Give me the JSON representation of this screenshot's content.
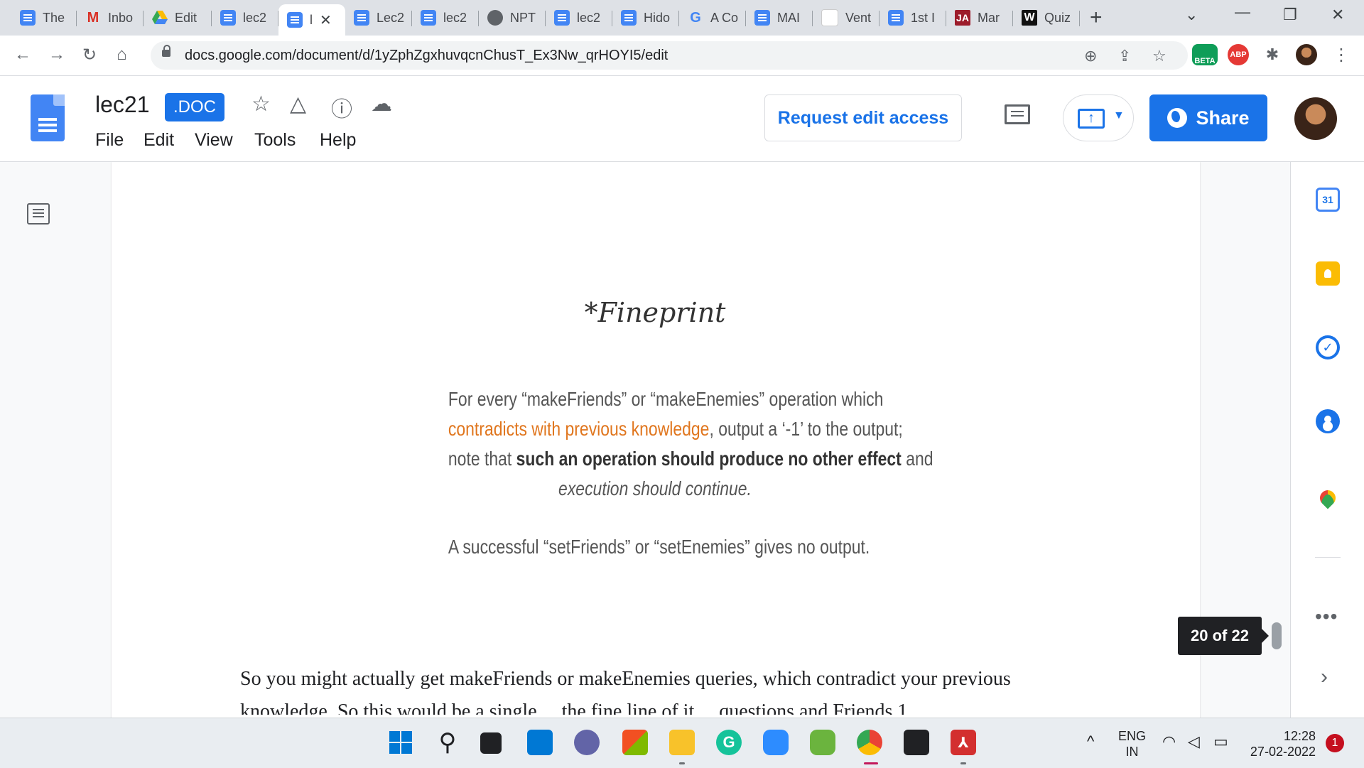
{
  "tabs": [
    {
      "label": "The",
      "icon": "docs-icon",
      "active": false
    },
    {
      "label": "Inbo",
      "icon": "gmail-icon",
      "active": false
    },
    {
      "label": "Edit",
      "icon": "drive-icon",
      "active": false
    },
    {
      "label": "lec2",
      "icon": "docs-icon",
      "active": false
    },
    {
      "label": "l",
      "icon": "docs-icon",
      "active": true
    },
    {
      "label": "Lec2",
      "icon": "docs-icon",
      "active": false
    },
    {
      "label": "lec2",
      "icon": "docs-icon",
      "active": false
    },
    {
      "label": "NPT",
      "icon": "globe-icon",
      "active": false
    },
    {
      "label": "lec2",
      "icon": "docs-icon",
      "active": false
    },
    {
      "label": "Hido",
      "icon": "docs-icon",
      "active": false
    },
    {
      "label": "A Co",
      "icon": "google-icon",
      "active": false
    },
    {
      "label": "MAI",
      "icon": "docs-icon",
      "active": false
    },
    {
      "label": "Vent",
      "icon": "blank-icon",
      "active": false
    },
    {
      "label": "1st I",
      "icon": "docs-icon",
      "active": false
    },
    {
      "label": "Mar",
      "icon": "ja-icon",
      "active": false
    },
    {
      "label": "Quiz",
      "icon": "w-icon",
      "active": false
    }
  ],
  "browser": {
    "url": "docs.google.com/document/d/1yZphZgxhuvqcnChusT_Ex3Nw_qrHOYI5/edit",
    "beta_label": "BETA",
    "abp_label": "ABP"
  },
  "doc": {
    "title": "lec21",
    "badge": ".DOC",
    "menu": [
      "File",
      "Edit",
      "View",
      "Tools",
      "Help"
    ],
    "request_edit": "Request edit access",
    "share": "Share"
  },
  "slide": {
    "heading": "*Fineprint",
    "line1": "For every “makeFriends” or “makeEnemies” operation which",
    "line2_orange": "contradicts with previous knowledge",
    "line2_rest": ", output a ‘-1’ to the output;",
    "line3_start": "note that ",
    "line3_bold": "such an operation should produce no other effect",
    "line3_end": " and",
    "line4": "execution should continue.",
    "line5": "A successful “setFriends” or “setEnemies” gives no output."
  },
  "body_text": "So you might actually get makeFriends or makeEnemies queries, which contradict your previous",
  "body_text_cut": "knowledge. So this would be a single …the fine line of it …questions and Friends 1 …",
  "page_count": "20 of 22",
  "side_panel": {
    "calendar_day": "31"
  },
  "taskbar": {
    "lang_top": "ENG",
    "lang_bottom": "IN",
    "time": "12:28",
    "date": "27-02-2022",
    "notifications": "1"
  },
  "colors": {
    "accent": "#1a73e8",
    "orange_text": "#e0761e",
    "page_count_bg": "#202124"
  }
}
